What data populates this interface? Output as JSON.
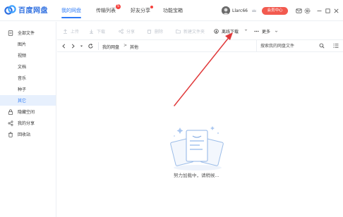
{
  "app": {
    "logo_text": "百度网盘",
    "nav_tabs": [
      {
        "label": "我的网盘",
        "active": true
      },
      {
        "label": "传输列表",
        "badge": "5"
      },
      {
        "label": "好友分享",
        "dot": true
      },
      {
        "label": "功能宝箱"
      }
    ],
    "user": {
      "name": "Llarc66",
      "member_button": "会员中心"
    }
  },
  "sidebar": {
    "items": [
      {
        "label": "全部文件",
        "icon": "file-icon"
      },
      {
        "label": "图片"
      },
      {
        "label": "视频"
      },
      {
        "label": "文档"
      },
      {
        "label": "音乐"
      },
      {
        "label": "种子"
      },
      {
        "label": "其它",
        "selected": true
      },
      {
        "label": "隐藏空间",
        "icon": "lock-icon"
      },
      {
        "label": "我的分享",
        "icon": "share-icon"
      },
      {
        "label": "回收站",
        "icon": "trash-icon"
      }
    ]
  },
  "toolbar": {
    "upload": "上传",
    "download": "下载",
    "share": "分享",
    "delete": "删除",
    "new_folder": "新建文件夹",
    "offline_download": "离线下载",
    "more": "更多"
  },
  "addressbar": {
    "breadcrumb": [
      "我的网盘",
      "其他"
    ],
    "separator": ">",
    "search_placeholder": "搜索我的网盘文件"
  },
  "main": {
    "loading_text": "努力加载中，请稍候..."
  },
  "colors": {
    "accent": "#2f7bf6",
    "selected_bg": "#e7f0fd",
    "member_button": "#f25a4f",
    "annotation_arrow": "#e0393a"
  }
}
